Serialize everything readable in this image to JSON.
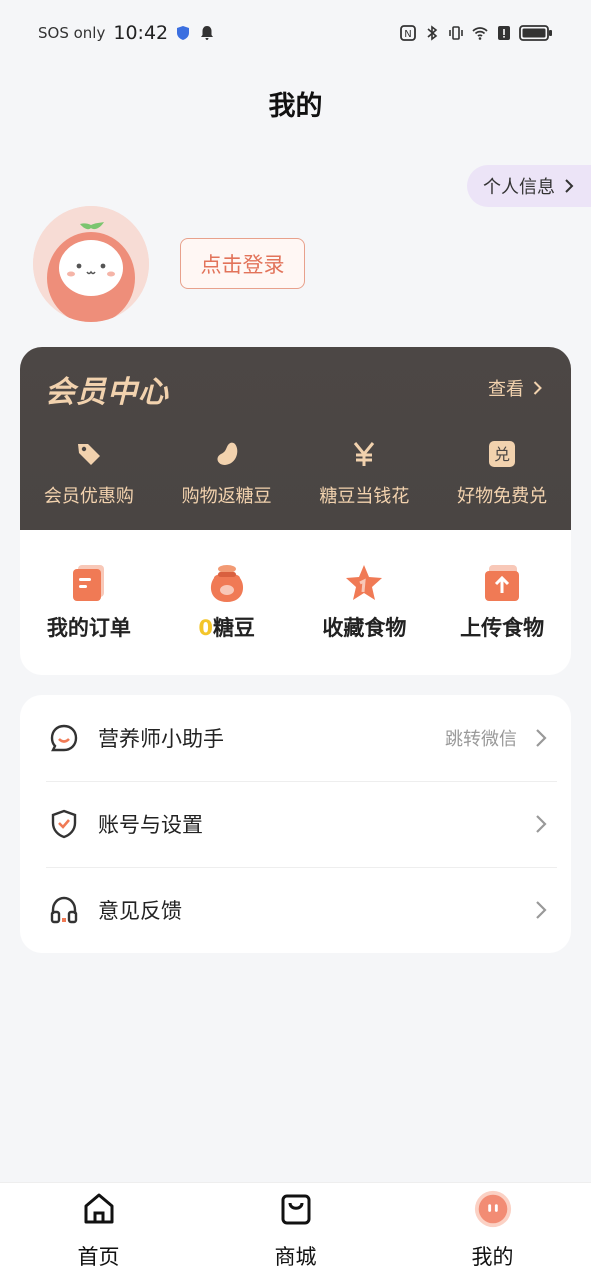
{
  "status_bar": {
    "carrier": "SOS only",
    "time": "10:42"
  },
  "header": {
    "title": "我的"
  },
  "profile": {
    "info_label": "个人信息",
    "login_label": "点击登录"
  },
  "member_center": {
    "title": "会员中心",
    "view_label": "查看",
    "benefits": [
      {
        "icon": "tag-icon",
        "label": "会员优惠购"
      },
      {
        "icon": "bean-icon",
        "label": "购物返糖豆"
      },
      {
        "icon": "yen-icon",
        "label": "糖豆当钱花"
      },
      {
        "icon": "exchange-icon",
        "label": "好物免费兑"
      }
    ],
    "accent_color": "#f2d2ae"
  },
  "quick_actions": [
    {
      "icon": "order-icon",
      "label": "我的订单"
    },
    {
      "icon": "bean-bag-icon",
      "count": "0",
      "label": "糖豆"
    },
    {
      "icon": "star-icon",
      "label": "收藏食物"
    },
    {
      "icon": "upload-icon",
      "label": "上传食物"
    }
  ],
  "menu": [
    {
      "icon": "chat-icon",
      "label": "营养师小助手",
      "hint": "跳转微信"
    },
    {
      "icon": "shield-icon",
      "label": "账号与设置",
      "hint": ""
    },
    {
      "icon": "headphones-icon",
      "label": "意见反馈",
      "hint": ""
    }
  ],
  "bottom_nav": [
    {
      "icon": "home-icon",
      "label": "首页",
      "active": false
    },
    {
      "icon": "shop-icon",
      "label": "商城",
      "active": false
    },
    {
      "icon": "profile-icon",
      "label": "我的",
      "active": true
    }
  ]
}
